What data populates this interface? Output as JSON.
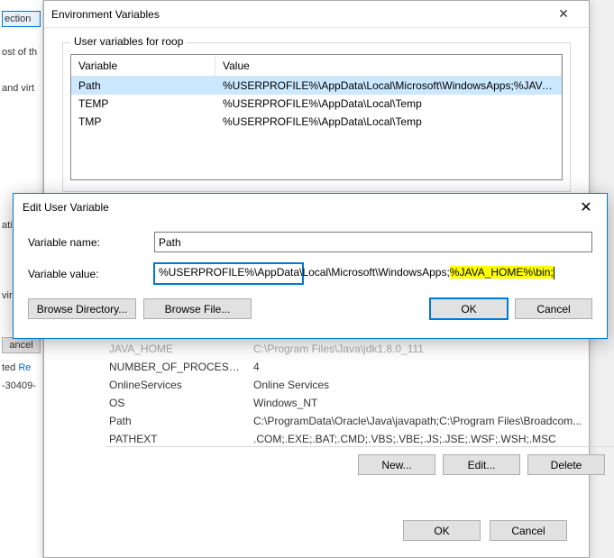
{
  "bg": {
    "frag1": "ection",
    "frag2": "ost of th",
    "frag3": "and virt",
    "frag4": "ation",
    "frag5": "viromer",
    "frag6": "ancel",
    "frag7": "ted",
    "frag8": "Re",
    "frag9": "-30409-"
  },
  "envDialog": {
    "title": "Environment Variables",
    "userGroupLabel": "User variables for roop",
    "colVariable": "Variable",
    "colValue": "Value",
    "userVars": [
      {
        "name": "Path",
        "value": "%USERPROFILE%\\AppData\\Local\\Microsoft\\WindowsApps;%JAVA_..."
      },
      {
        "name": "TEMP",
        "value": "%USERPROFILE%\\AppData\\Local\\Temp"
      },
      {
        "name": "TMP",
        "value": "%USERPROFILE%\\AppData\\Local\\Temp"
      }
    ],
    "sysVars": [
      {
        "name": "JAVA_HOME",
        "value": "C:\\Program Files\\Java\\jdk1.8.0_111"
      },
      {
        "name": "NUMBER_OF_PROCESSORS",
        "value": "4"
      },
      {
        "name": "OnlineServices",
        "value": "Online Services"
      },
      {
        "name": "OS",
        "value": "Windows_NT"
      },
      {
        "name": "Path",
        "value": "C:\\ProgramData\\Oracle\\Java\\javapath;C:\\Program Files\\Broadcom..."
      },
      {
        "name": "PATHEXT",
        "value": ".COM;.EXE;.BAT;.CMD;.VBS;.VBE;.JS;.JSE;.WSF;.WSH;.MSC"
      }
    ],
    "newBtn": "New...",
    "editBtn": "Edit...",
    "deleteBtn": "Delete",
    "okBtn": "OK",
    "cancelBtn": "Cancel"
  },
  "editDialog": {
    "title": "Edit User Variable",
    "nameLabel": "Variable name:",
    "nameValue": "Path",
    "valueLabel": "Variable value:",
    "valuePlain": "%USERPROFILE%\\AppData\\Local\\Microsoft\\WindowsApps;",
    "valueHighlight": "%JAVA_HOME%\\bin;",
    "browseDir": "Browse Directory...",
    "browseFile": "Browse File...",
    "ok": "OK",
    "cancel": "Cancel"
  }
}
